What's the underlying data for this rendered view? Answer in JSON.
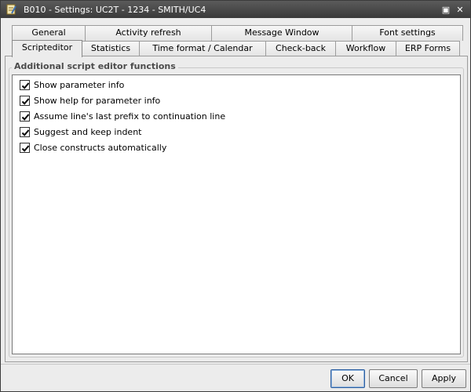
{
  "window": {
    "title": "B010 - Settings: UC2T - 1234 - SMITH/UC4",
    "restore_glyph": "▣",
    "close_glyph": "✕"
  },
  "tabs_top": [
    {
      "label": "General"
    },
    {
      "label": "Activity refresh"
    },
    {
      "label": "Message Window"
    },
    {
      "label": "Font settings"
    }
  ],
  "tabs_bottom": [
    {
      "label": "Scripteditor",
      "active": true
    },
    {
      "label": "Statistics"
    },
    {
      "label": "Time format / Calendar"
    },
    {
      "label": "Check-back"
    },
    {
      "label": "Workflow"
    },
    {
      "label": "ERP Forms"
    }
  ],
  "group": {
    "legend": "Additional script editor functions",
    "options": [
      {
        "label": "Show parameter info",
        "checked": true
      },
      {
        "label": "Show help for parameter info",
        "checked": true
      },
      {
        "label": "Assume line's last prefix to continuation line",
        "checked": true
      },
      {
        "label": "Suggest and keep indent",
        "checked": true
      },
      {
        "label": "Close constructs automatically",
        "checked": true
      }
    ]
  },
  "buttons": {
    "ok": "OK",
    "cancel": "Cancel",
    "apply": "Apply"
  }
}
